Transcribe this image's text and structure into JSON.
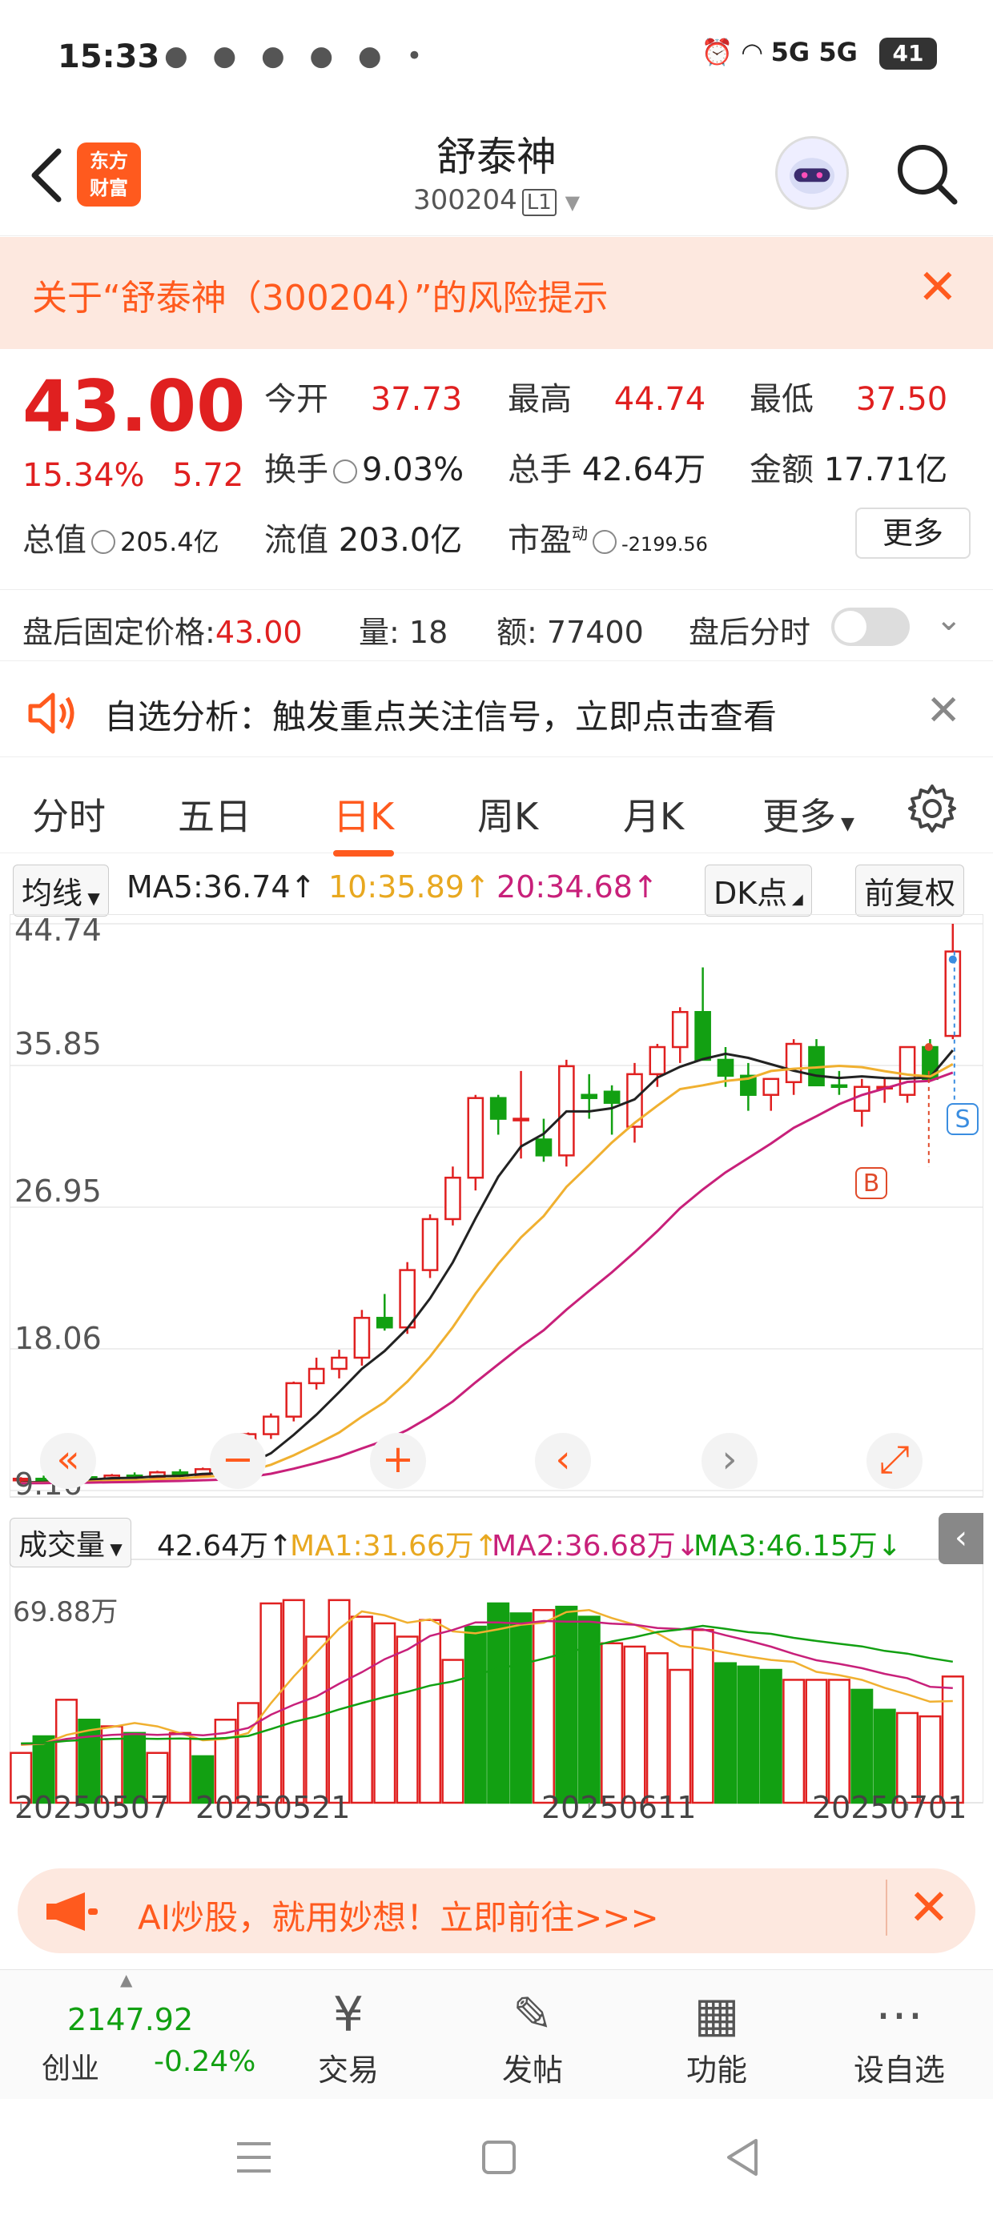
{
  "status_bar": {
    "time": "15:33",
    "network": "5G 5G",
    "battery": "41"
  },
  "header": {
    "logo_line1": "东方",
    "logo_line2": "财富",
    "stock_name": "舒泰神",
    "stock_code": "300204",
    "level": "L1"
  },
  "risk_banner": {
    "text": "关于“舒泰神（300204）”的风险提示"
  },
  "quote": {
    "price": "43.00",
    "change_pct": "15.34%",
    "change_amt": "5.72",
    "open_label": "今开",
    "open": "37.73",
    "high_label": "最高",
    "high": "44.74",
    "low_label": "最低",
    "low": "37.50",
    "turnover_label": "换手",
    "turnover": "9.03%",
    "volume_label": "总手",
    "volume": "42.64万",
    "amount_label": "金额",
    "amount": "17.71亿",
    "mktcap_label": "总值",
    "mktcap": "205.4亿",
    "float_label": "流值",
    "float": "203.0亿",
    "pe_label": "市盈",
    "pe_sup": "动",
    "pe": "-2199.56",
    "more_label": "更多"
  },
  "after_hours": {
    "price_label": "盘后固定价格:",
    "price": "43.00",
    "qty_label": "量:",
    "qty": "18",
    "amt_label": "额:",
    "amt": "77400",
    "timeshare_label": "盘后分时"
  },
  "analysis_banner": {
    "text": "自选分析：触发重点关注信号，立即点击查看"
  },
  "tabs": [
    "分时",
    "五日",
    "日K",
    "周K",
    "月K",
    "更多"
  ],
  "ma_header": {
    "selector": "均线",
    "ma5": "MA5:36.74↑",
    "ma10": "10:35.89↑",
    "ma20": "20:34.68↑",
    "dk": "DK点",
    "adjust": "前复权"
  },
  "colors": {
    "up": "#e02020",
    "down": "#12a012",
    "ma5": "#222222",
    "ma10": "#f0b030",
    "ma20": "#c8207a",
    "accent": "#ff5a1e"
  },
  "chart_data": [
    {
      "type": "candlestick",
      "title": "日K",
      "y_ticks": [
        "44.74",
        "35.85",
        "26.95",
        "18.06",
        "9.16"
      ],
      "ylim": [
        9.16,
        44.74
      ],
      "x_labels": [
        "20250507",
        "20250521",
        "20250611",
        "20250701"
      ],
      "markers": [
        "B",
        "S"
      ],
      "series": [
        {
          "name": "MA5",
          "value": "36.74"
        },
        {
          "name": "MA10",
          "value": "35.89"
        },
        {
          "name": "MA20",
          "value": "34.68"
        }
      ],
      "candles": [
        [
          9.8,
          10.0,
          9.6,
          9.9
        ],
        [
          9.9,
          10.1,
          9.7,
          9.8
        ],
        [
          9.8,
          10.1,
          9.7,
          10.0
        ],
        [
          10.0,
          10.2,
          9.8,
          9.9
        ],
        [
          9.9,
          10.2,
          9.8,
          10.1
        ],
        [
          10.1,
          10.3,
          9.9,
          10.0
        ],
        [
          10.0,
          10.4,
          9.9,
          10.3
        ],
        [
          10.3,
          10.5,
          10.0,
          10.1
        ],
        [
          10.1,
          10.6,
          10.0,
          10.5
        ],
        [
          10.5,
          10.9,
          10.3,
          10.4
        ],
        [
          10.5,
          12.8,
          10.4,
          12.7
        ],
        [
          12.7,
          14.0,
          12.4,
          13.8
        ],
        [
          13.8,
          16.0,
          13.5,
          15.9
        ],
        [
          15.9,
          17.5,
          15.5,
          16.8
        ],
        [
          16.8,
          18.0,
          16.2,
          17.5
        ],
        [
          17.5,
          20.5,
          17.0,
          20.0
        ],
        [
          20.0,
          21.5,
          19.2,
          19.4
        ],
        [
          19.4,
          23.5,
          19.0,
          23.0
        ],
        [
          23.0,
          26.5,
          22.5,
          26.2
        ],
        [
          26.2,
          29.5,
          25.8,
          28.8
        ],
        [
          28.8,
          34.0,
          28.0,
          33.8
        ],
        [
          33.8,
          34.0,
          31.5,
          32.5
        ],
        [
          32.5,
          35.5,
          30.0,
          32.5
        ],
        [
          31.2,
          32.5,
          29.8,
          30.2
        ],
        [
          30.2,
          36.2,
          29.5,
          35.8
        ],
        [
          34.0,
          35.3,
          32.5,
          33.8
        ],
        [
          34.2,
          34.6,
          31.5,
          33.5
        ],
        [
          32.0,
          36.0,
          31.0,
          35.3
        ],
        [
          35.3,
          37.2,
          34.5,
          37.0
        ],
        [
          37.0,
          39.5,
          36.0,
          39.2
        ],
        [
          39.2,
          42.0,
          38.3,
          36.2
        ],
        [
          36.2,
          37.0,
          34.5,
          35.2
        ],
        [
          35.2,
          36.0,
          33.0,
          34.0
        ],
        [
          34.0,
          35.0,
          33.0,
          35.0
        ],
        [
          34.8,
          37.5,
          34.0,
          37.2
        ],
        [
          37.0,
          37.5,
          35.0,
          34.6
        ],
        [
          34.6,
          35.5,
          34.0,
          34.5
        ],
        [
          33.0,
          35.0,
          32.0,
          34.5
        ],
        [
          34.5,
          35.0,
          33.5,
          34.5
        ],
        [
          34.0,
          37.0,
          33.5,
          37.0
        ],
        [
          37.0,
          37.5,
          35.0,
          35.0
        ],
        [
          37.7,
          44.74,
          37.5,
          43.0
        ]
      ]
    },
    {
      "type": "bar",
      "title": "成交量",
      "y_top_label": "69.88万",
      "values_wan": [
        15,
        20,
        31,
        25,
        23,
        21,
        15,
        21,
        14,
        25,
        30,
        60,
        61,
        50,
        61,
        56,
        54,
        50,
        55,
        43,
        53,
        60,
        57,
        58,
        59,
        56,
        48,
        47,
        45,
        40,
        52,
        42,
        41,
        40,
        37,
        37,
        37,
        34,
        28,
        27,
        26,
        38
      ],
      "colors_series": [
        "up",
        "down",
        "up",
        "down",
        "up",
        "down",
        "up",
        "up",
        "down",
        "up",
        "up",
        "up",
        "up",
        "up",
        "up",
        "up",
        "up",
        "up",
        "up",
        "up",
        "down",
        "down",
        "down",
        "up",
        "down",
        "down",
        "up",
        "up",
        "up",
        "up",
        "up",
        "down",
        "down",
        "down",
        "up",
        "up",
        "up",
        "down",
        "down",
        "up",
        "up",
        "up"
      ],
      "series": [
        {
          "name": "VOL",
          "value": "42.64万↑"
        },
        {
          "name": "MA1",
          "value": "31.66万↑"
        },
        {
          "name": "MA2",
          "value": "36.68万↓"
        },
        {
          "name": "MA3",
          "value": "46.15万↓"
        }
      ]
    }
  ],
  "volume_header": {
    "selector": "成交量",
    "vol": "42.64万↑",
    "ma1": "MA1:31.66万↑",
    "ma2": "MA2:36.68万↓",
    "ma3": "MA3:46.15万↓"
  },
  "ai_banner": {
    "text": "AI炒股，就用妙想！立即前往>>>"
  },
  "bottom_nav": {
    "index_value": "2147.92",
    "index_name": "创业",
    "index_change": "-0.24%",
    "items": [
      {
        "label": "交易",
        "icon": "yen-icon"
      },
      {
        "label": "发帖",
        "icon": "edit-icon"
      },
      {
        "label": "功能",
        "icon": "grid-icon"
      },
      {
        "label": "设自选",
        "icon": "more-icon"
      }
    ]
  }
}
